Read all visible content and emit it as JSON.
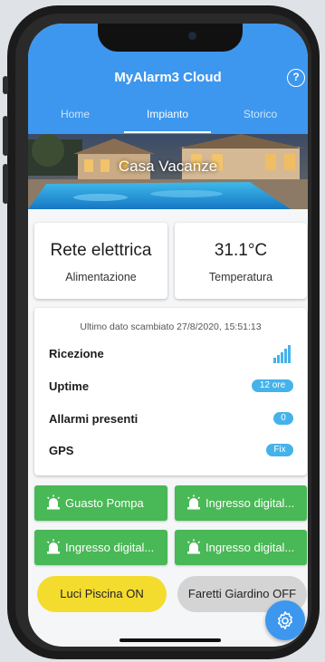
{
  "app": {
    "title": "MyAlarm3 Cloud"
  },
  "tabs": [
    {
      "label": "Home"
    },
    {
      "label": "Impianto"
    },
    {
      "label": "Storico"
    }
  ],
  "hero": {
    "title": "Casa Vacanze"
  },
  "stats": [
    {
      "value": "Rete elettrica",
      "label": "Alimentazione"
    },
    {
      "value": "31.1°C",
      "label": "Temperatura"
    }
  ],
  "info": {
    "last_exchange": "Ultimo dato scambiato 27/8/2020, 15:51:13",
    "rows": [
      {
        "label": "Ricezione",
        "kind": "signal-bars"
      },
      {
        "label": "Uptime",
        "badge": "12 ore"
      },
      {
        "label": "Allarmi presenti",
        "badge": "0"
      },
      {
        "label": "GPS",
        "badge": "Fix"
      }
    ]
  },
  "alarm_buttons": [
    {
      "label": "Guasto Pompa"
    },
    {
      "label": "Ingresso digital..."
    },
    {
      "label": "Ingresso digital..."
    },
    {
      "label": "Ingresso digital..."
    }
  ],
  "toggles": [
    {
      "label": "Luci Piscina ON"
    },
    {
      "label": "Faretti Giardino OFF"
    }
  ],
  "colors": {
    "primary": "#3d97ee",
    "green": "#49b856",
    "yellow": "#f4dc2f",
    "badge": "#45b3ea",
    "gray": "#d4d4d4"
  },
  "icons": {
    "help": "question-mark-circle",
    "signal": "signal-bars",
    "alarm": "siren-light",
    "settings": "gear"
  }
}
